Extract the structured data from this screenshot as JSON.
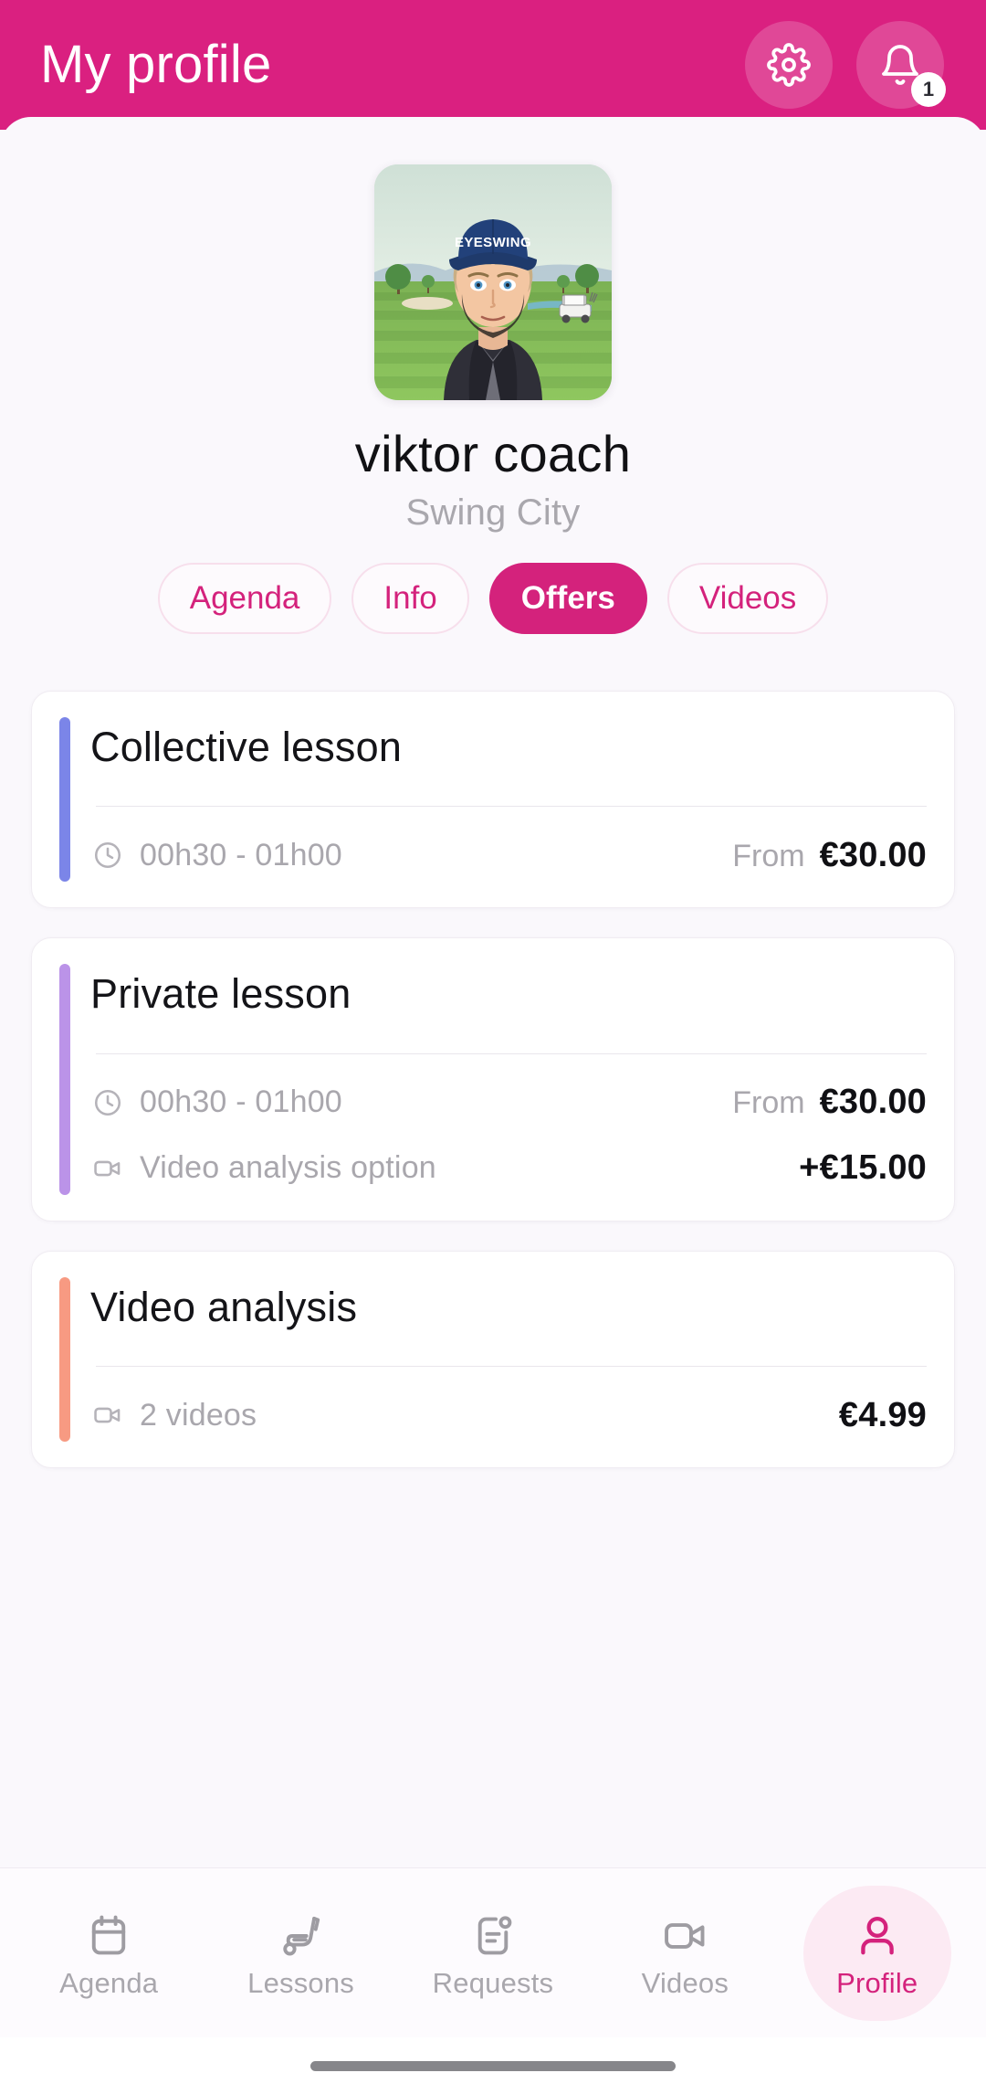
{
  "header": {
    "title": "My profile",
    "settings_icon": "gear-icon",
    "notifications_icon": "bell-icon",
    "notification_count": "1"
  },
  "profile": {
    "avatar_alt": "avatar-illustration-golf-coach",
    "avatar_cap_text": "EYESWING",
    "name": "viktor coach",
    "club": "Swing City"
  },
  "tabs": [
    {
      "label": "Agenda",
      "active": false
    },
    {
      "label": "Info",
      "active": false
    },
    {
      "label": "Offers",
      "active": true
    },
    {
      "label": "Videos",
      "active": false
    }
  ],
  "offers": [
    {
      "title": "Collective lesson",
      "accent_color": "#7b85e8",
      "rows": [
        {
          "icon": "clock-icon",
          "label": "00h30 - 01h00",
          "price_prefix": "From",
          "price": "€30.00"
        }
      ]
    },
    {
      "title": "Private lesson",
      "accent_color": "#bb93e8",
      "rows": [
        {
          "icon": "clock-icon",
          "label": "00h30 - 01h00",
          "price_prefix": "From",
          "price": "€30.00"
        },
        {
          "icon": "video-icon",
          "label": "Video analysis option",
          "price_prefix": "",
          "price": "+€15.00"
        }
      ]
    },
    {
      "title": "Video analysis",
      "accent_color": "#f79a82",
      "rows": [
        {
          "icon": "video-icon",
          "label": "2 videos",
          "price_prefix": "",
          "price": "€4.99"
        }
      ]
    }
  ],
  "bottom_nav": [
    {
      "label": "Agenda",
      "icon": "calendar-icon",
      "active": false
    },
    {
      "label": "Lessons",
      "icon": "golf-club-icon",
      "active": false
    },
    {
      "label": "Requests",
      "icon": "requests-document-icon",
      "active": false
    },
    {
      "label": "Videos",
      "icon": "video-camera-icon",
      "active": false
    },
    {
      "label": "Profile",
      "icon": "person-icon",
      "active": true
    }
  ],
  "colors": {
    "brand_pink": "#da2080",
    "accent_pink": "#d4227c",
    "background": "#faf8fc",
    "card": "#ffffff",
    "muted_text": "#a9a7ad"
  }
}
